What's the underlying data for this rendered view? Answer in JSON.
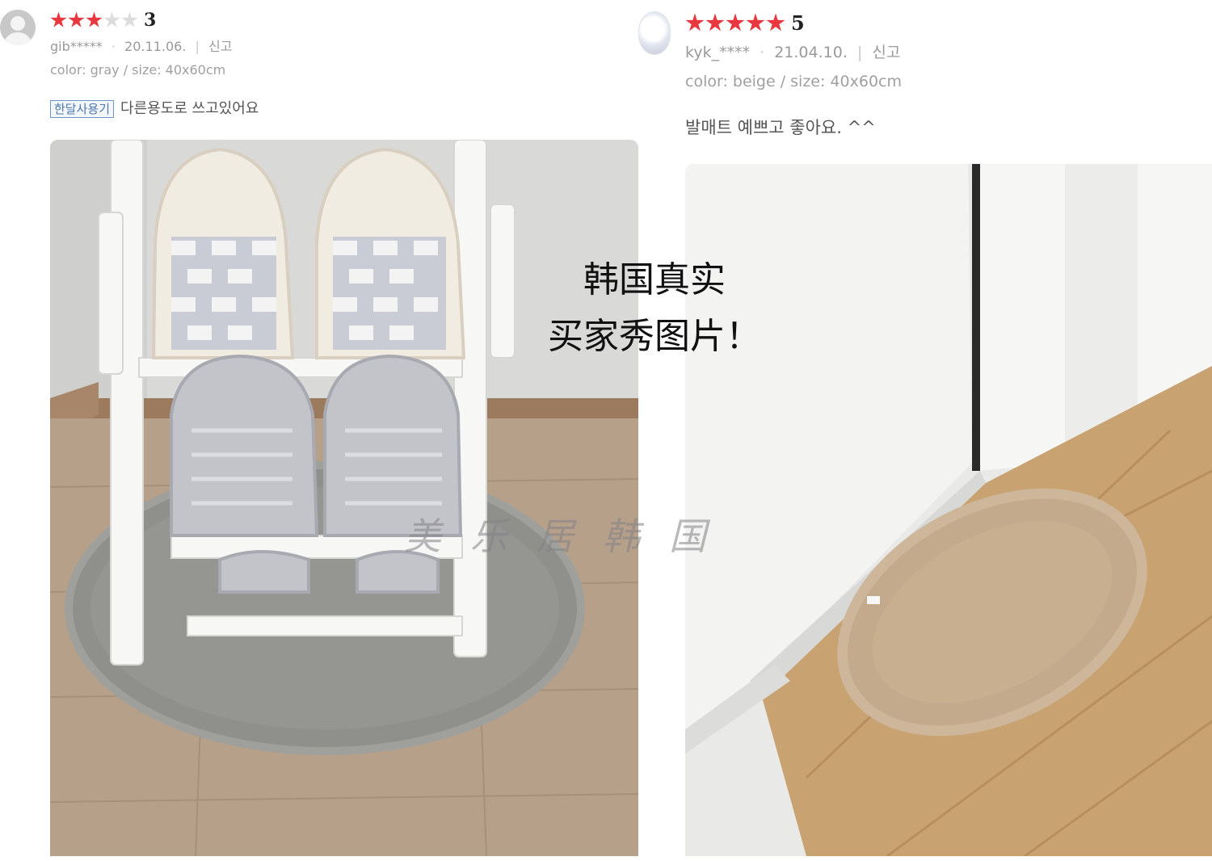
{
  "reviews": [
    {
      "rating": 3,
      "rating_max": 5,
      "rating_text": "3",
      "user": "gib*****",
      "date": "20.11.06.",
      "report": "신고",
      "option": "color: gray / size: 40x60cm",
      "badge": "한달사용기",
      "text": "다른용도로 쓰고있어요"
    },
    {
      "rating": 5,
      "rating_max": 5,
      "rating_text": "5",
      "user": "kyk_****",
      "date": "21.04.10.",
      "report": "신고",
      "option": "color: beige / size: 40x60cm",
      "text": "발매트 예쁘고 좋아요. ^^"
    }
  ],
  "overlay": {
    "line1": "韩国真实",
    "line2": "买家秀图片！"
  },
  "watermark": "美乐居韩国",
  "colors": {
    "star_on": "#e8373f",
    "star_off": "#dcdcdc",
    "badge_border": "#6f95c4"
  }
}
